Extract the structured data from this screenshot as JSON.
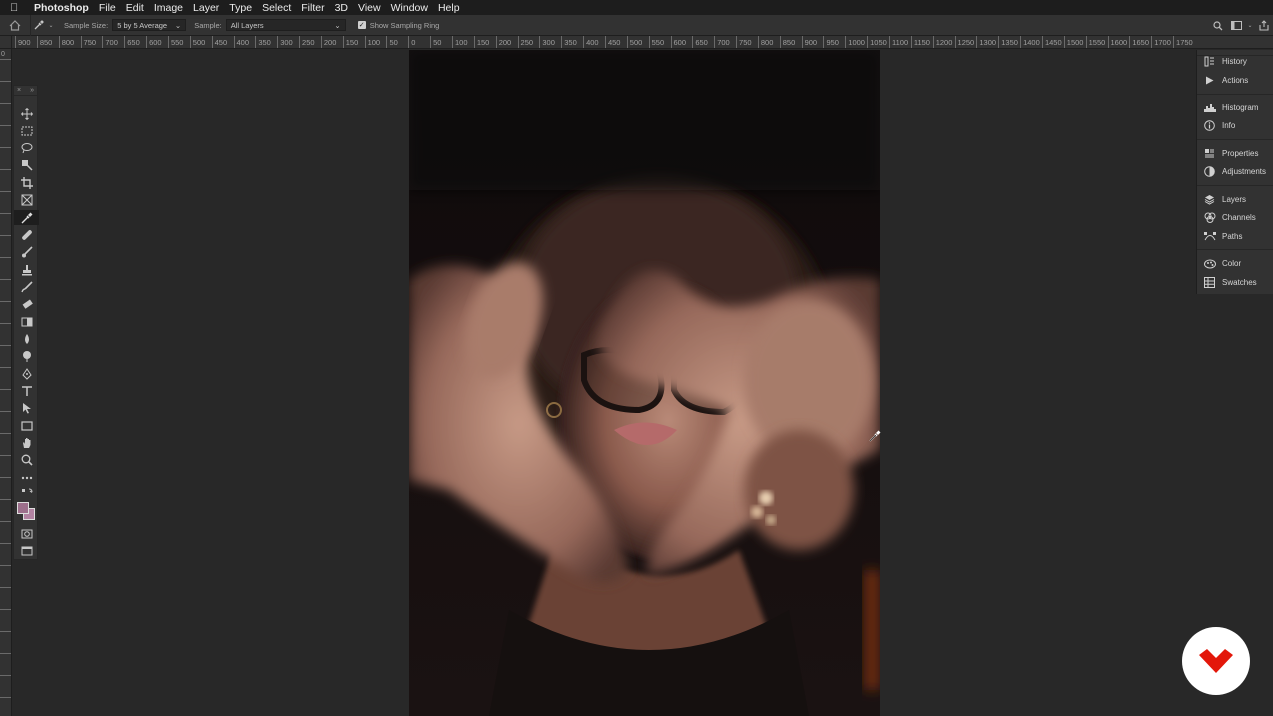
{
  "menubar": {
    "app": "Photoshop",
    "items": [
      "File",
      "Edit",
      "Image",
      "Layer",
      "Type",
      "Select",
      "Filter",
      "3D",
      "View",
      "Window",
      "Help"
    ]
  },
  "options_bar": {
    "sample_size_label": "Sample Size:",
    "sample_size_value": "5 by 5 Average",
    "sample_label": "Sample:",
    "sample_value": "All Layers",
    "show_ring_label": "Show Sampling Ring",
    "show_ring_checked": true
  },
  "ruler_h_labels": [
    "900",
    "850",
    "800",
    "750",
    "700",
    "650",
    "600",
    "550",
    "500",
    "450",
    "400",
    "350",
    "300",
    "250",
    "200",
    "150",
    "100",
    "50",
    "0",
    "50",
    "100",
    "150",
    "200",
    "250",
    "300",
    "350",
    "400",
    "450",
    "500",
    "550",
    "600",
    "650",
    "700",
    "750",
    "800",
    "850",
    "900",
    "950",
    "1000",
    "1050",
    "1100",
    "1150",
    "1200",
    "1250",
    "1300",
    "1350",
    "1400",
    "1450",
    "1500",
    "1550",
    "1600",
    "1650",
    "1700",
    "1750"
  ],
  "ruler_v_label": "0",
  "toolbox": {
    "head_left": "×",
    "head_right": "»",
    "tools": [
      "move-tool",
      "marquee-tool",
      "lasso-tool",
      "quick-select-tool",
      "crop-tool",
      "frame-tool",
      "eyedropper-tool",
      "healing-brush-tool",
      "brush-tool",
      "clone-stamp-tool",
      "history-brush-tool",
      "eraser-tool",
      "gradient-tool",
      "blur-tool",
      "dodge-tool",
      "pen-tool",
      "type-tool",
      "path-select-tool",
      "rectangle-tool",
      "hand-tool",
      "zoom-tool",
      "edit-toolbar"
    ],
    "active_tool": "eyedropper-tool",
    "foreground_color": "#9c6f8b",
    "background_color": "#b283a2"
  },
  "panels": [
    {
      "label": "History",
      "icon": "history-icon"
    },
    {
      "label": "Actions",
      "icon": "play-icon"
    },
    {
      "label": "Histogram",
      "icon": "histogram-icon"
    },
    {
      "label": "Info",
      "icon": "info-icon"
    },
    {
      "label": "Properties",
      "icon": "properties-icon"
    },
    {
      "label": "Adjustments",
      "icon": "adjustments-icon"
    },
    {
      "label": "Layers",
      "icon": "layers-icon"
    },
    {
      "label": "Channels",
      "icon": "channels-icon"
    },
    {
      "label": "Paths",
      "icon": "paths-icon"
    },
    {
      "label": "Color",
      "icon": "color-icon"
    },
    {
      "label": "Swatches",
      "icon": "swatches-icon"
    }
  ],
  "brand_color": "#e3170a"
}
